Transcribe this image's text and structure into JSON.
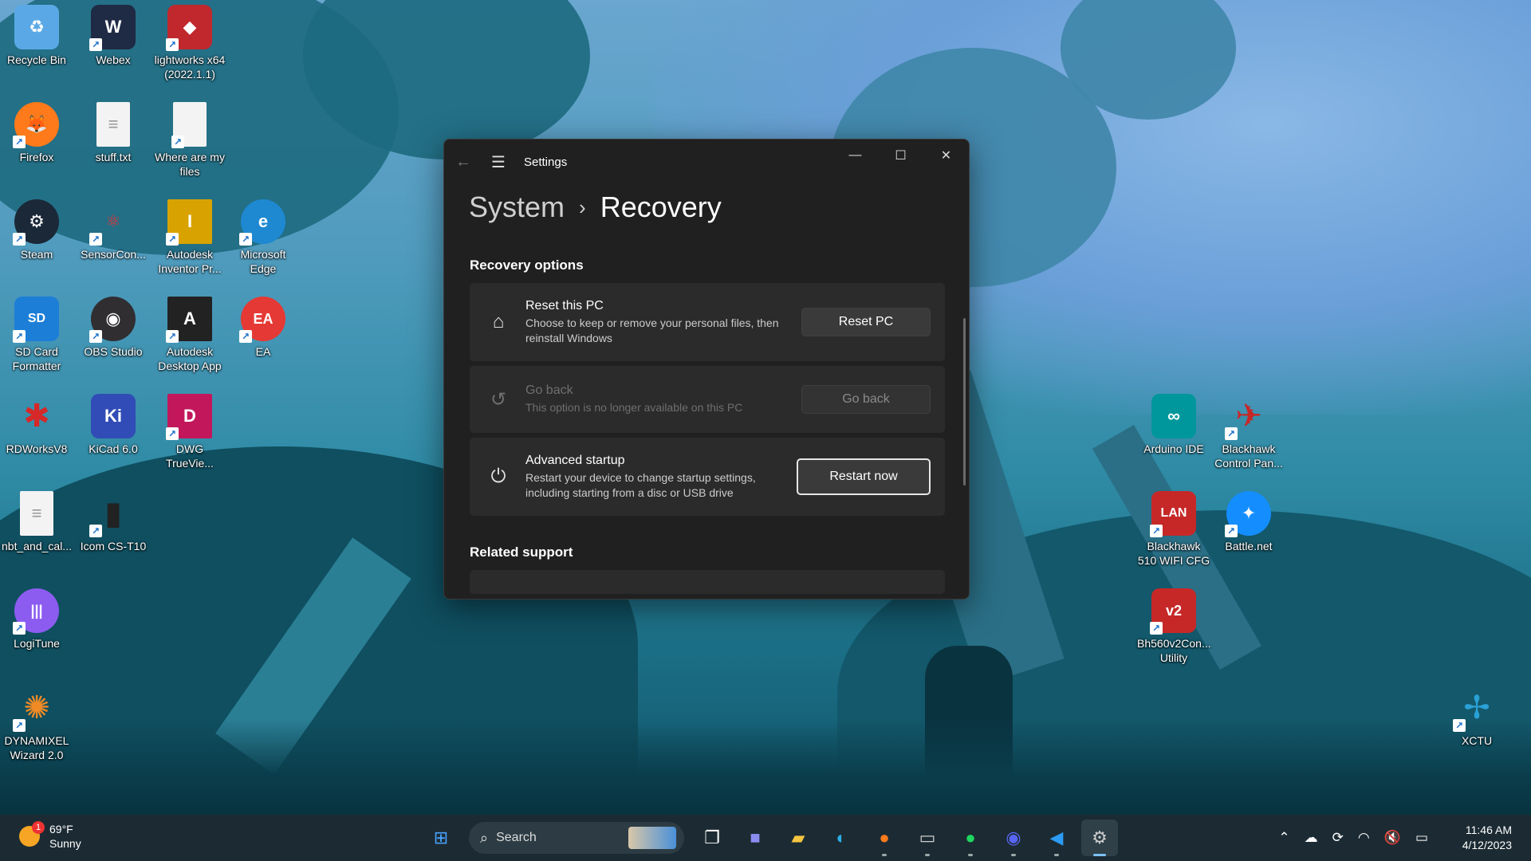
{
  "desktop": {
    "icons": [
      {
        "label": "Recycle Bin",
        "glyph": "♻",
        "color": "#5aa9e6"
      },
      {
        "label": "Webex",
        "glyph": "W",
        "color": "#1f2a44"
      },
      {
        "label": "lightworks x64 (2022.1.1)",
        "glyph": "◆",
        "color": "#c0282d"
      },
      {
        "label": "Firefox",
        "glyph": "🦊",
        "color": "#ff7a1a"
      },
      {
        "label": "stuff.txt",
        "glyph": "≡",
        "color": "#f3f3f3"
      },
      {
        "label": "Where are my files",
        "glyph": "",
        "color": "#f3f3f3"
      },
      {
        "label": "Steam",
        "glyph": "⚙",
        "color": "#1b2838"
      },
      {
        "label": "SensorCon...",
        "glyph": "⚛",
        "color": "#e8e8e8"
      },
      {
        "label": "Autodesk Inventor Pr...",
        "glyph": "I",
        "color": "#d8a300"
      },
      {
        "label": "Microsoft Edge",
        "glyph": "e",
        "color": "#1e88d1"
      },
      {
        "label": "SD Card Formatter",
        "glyph": "SD",
        "color": "#1c7ed6"
      },
      {
        "label": "OBS Studio",
        "glyph": "◉",
        "color": "#302e31"
      },
      {
        "label": "Autodesk Desktop App",
        "glyph": "A",
        "color": "#222"
      },
      {
        "label": "EA",
        "glyph": "EA",
        "color": "#e53935"
      },
      {
        "label": "RDWorksV8",
        "glyph": "✱",
        "color": "#d62828"
      },
      {
        "label": "KiCad 6.0",
        "glyph": "Ki",
        "color": "#314cb6"
      },
      {
        "label": "DWG TrueVie...",
        "glyph": "D",
        "color": "#c2185b"
      },
      {
        "label": "nbt_and_cal...",
        "glyph": "≡",
        "color": "#f3f3f3"
      },
      {
        "label": "Icom CS-T10",
        "glyph": "▮",
        "color": "#333"
      },
      {
        "label": "LogiTune",
        "glyph": "|||",
        "color": "#8c5cf0"
      },
      {
        "label": "DYNAMIXEL Wizard 2.0",
        "glyph": "✺",
        "color": "#f08a24"
      },
      {
        "label": "Arduino IDE",
        "glyph": "∞",
        "color": "#00979c"
      },
      {
        "label": "Blackhawk Control Pan...",
        "glyph": "✈",
        "color": "#c62828"
      },
      {
        "label": "Blackhawk 510 WIFI CFG",
        "glyph": "LAN",
        "color": "#c62828"
      },
      {
        "label": "Battle.net",
        "glyph": "✦",
        "color": "#148eff"
      },
      {
        "label": "Bh560v2Con... Utility",
        "glyph": "v2",
        "color": "#c62828"
      },
      {
        "label": "XCTU",
        "glyph": "✢",
        "color": "#2aa1d6"
      }
    ]
  },
  "settings": {
    "title": "Settings",
    "breadcrumb": {
      "parent": "System",
      "separator": "›",
      "current": "Recovery"
    },
    "section_recovery": "Recovery options",
    "reset": {
      "title": "Reset this PC",
      "desc": "Choose to keep or remove your personal files, then reinstall Windows",
      "button": "Reset PC"
    },
    "goback": {
      "title": "Go back",
      "desc": "This option is no longer available on this PC",
      "button": "Go back"
    },
    "advanced": {
      "title": "Advanced startup",
      "desc": "Restart your device to change startup settings, including starting from a disc or USB drive",
      "button": "Restart now"
    },
    "section_related": "Related support"
  },
  "taskbar": {
    "weather": {
      "temp": "69°F",
      "cond": "Sunny",
      "badge": "1"
    },
    "search_label": "Search",
    "time": "11:46 AM",
    "date": "4/12/2023"
  }
}
